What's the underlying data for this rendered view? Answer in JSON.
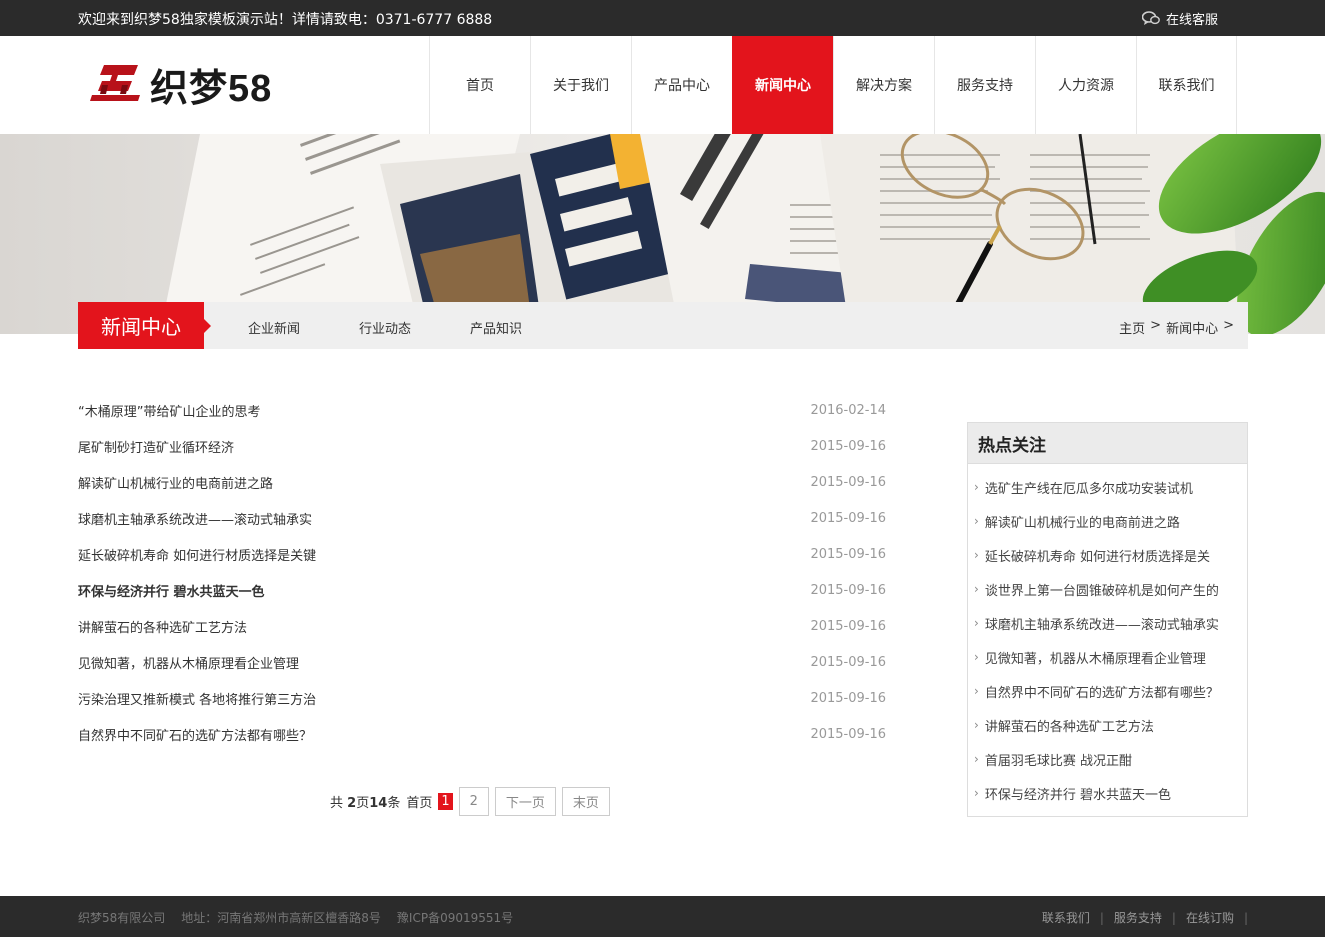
{
  "topbar": {
    "welcome": "欢迎来到织梦58独家模板演示站！详情请致电：0371-6777 6888",
    "service": "在线客服"
  },
  "header": {
    "logo_text": "织梦58",
    "nav": [
      "首页",
      "关于我们",
      "产品中心",
      "新闻中心",
      "解决方案",
      "服务支持",
      "人力资源",
      "联系我们"
    ],
    "active_nav": "新闻中心"
  },
  "subnav": {
    "title": "新闻中心",
    "links": [
      "企业新闻",
      "行业动态",
      "产品知识"
    ],
    "breadcrumb": [
      "主页",
      ">",
      "新闻中心",
      ">"
    ]
  },
  "news": [
    {
      "title": "“木桶原理”带给矿山企业的思考",
      "date": "2016-02-14"
    },
    {
      "title": "尾矿制砂打造矿业循环经济",
      "date": "2015-09-16"
    },
    {
      "title": "解读矿山机械行业的电商前进之路",
      "date": "2015-09-16"
    },
    {
      "title": "球磨机主轴承系统改进——滚动式轴承实",
      "date": "2015-09-16"
    },
    {
      "title": "延长破碎机寿命 如何进行材质选择是关键",
      "date": "2015-09-16"
    },
    {
      "title": "环保与经济并行 碧水共蓝天一色",
      "date": "2015-09-16"
    },
    {
      "title": "讲解萤石的各种选矿工艺方法",
      "date": "2015-09-16"
    },
    {
      "title": "见微知著，机器从木桶原理看企业管理",
      "date": "2015-09-16"
    },
    {
      "title": "污染治理又推新模式 各地将推行第三方治",
      "date": "2015-09-16"
    },
    {
      "title": "自然界中不同矿石的选矿方法都有哪些？",
      "date": "2015-09-16"
    }
  ],
  "pagination": {
    "prefix": "共",
    "pages": "2",
    "pages_unit": "页",
    "items": "14",
    "items_unit": "条",
    "first": "首页",
    "current": "1",
    "page2": "2",
    "next": "下一页",
    "last": "末页"
  },
  "sidebar": {
    "title": "热点关注",
    "items": [
      "选矿生产线在厄瓜多尔成功安装试机",
      "解读矿山机械行业的电商前进之路",
      "延长破碎机寿命 如何进行材质选择是关",
      "谈世界上第一台圆锥破碎机是如何产生的",
      "球磨机主轴承系统改进——滚动式轴承实",
      "见微知著，机器从木桶原理看企业管理",
      "自然界中不同矿石的选矿方法都有哪些？",
      "讲解萤石的各种选矿工艺方法",
      "首届羽毛球比赛 战况正酣",
      "环保与经济并行 碧水共蓝天一色"
    ]
  },
  "footer": {
    "company": "织梦58有限公司",
    "address": "地址：河南省郑州市高新区檀香路8号",
    "icp": "豫ICP备09019551号",
    "links": [
      "联系我们",
      "服务支持",
      "在线订购"
    ]
  },
  "colors": {
    "accent": "#e3141c",
    "topbar_bg": "#2b2b2b",
    "footer_bg": "#2b2b2b",
    "date_gray": "#999999"
  }
}
